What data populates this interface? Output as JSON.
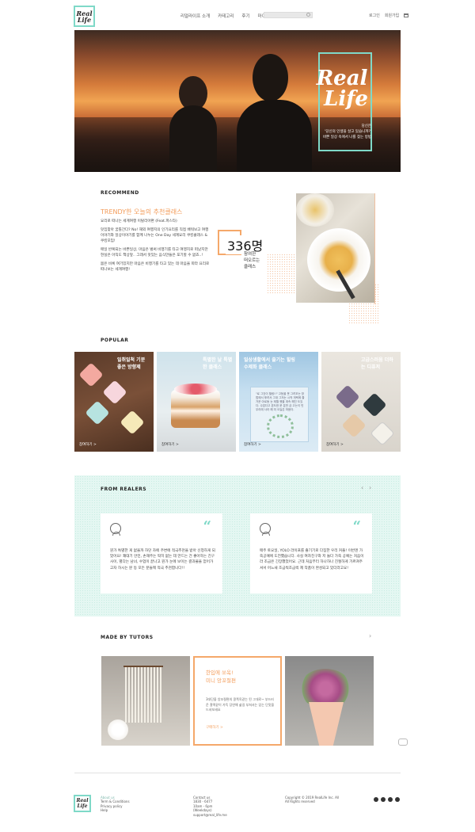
{
  "header": {
    "logo_line1": "Real",
    "logo_line2": "Life",
    "nav": [
      "리얼라이프 소개",
      "카테고리",
      "후기",
      "마이페이지"
    ],
    "search_placeholder": "",
    "login": "로그인",
    "signup": "회원가입"
  },
  "hero": {
    "title_line1": "Real",
    "title_line2": "Life",
    "sub_line1": "당신은",
    "sub_line2": "'당신의 인생을 살고 있습니까?'",
    "sub_line3": "바쁜 일상 속에서 나를 찾는 방법"
  },
  "recommend": {
    "label": "RECOMMEND",
    "title": "TRENDY한 오늘의 추천클래스",
    "paragraphs": [
      "요리로 떠나는 세계여행 이탈리아편 (Feat.파스타)",
      "맛집찾아 꿈틀간다? No! 해외 여행지의 인기요리를 직접 배워보고 여행이야기와 일상이야기를 함께 나누는 One Day 세계요리 쿠킹클래스 & 쿠킹모임!",
      "매일 반복되는 바쁜일상, 마음은 벌써 비행기를 타고 여행지로 떠났지만 현실은 아직도 책상앞.. 그래서 맛있는 음식만들은 포기할 수 없죠..!",
      "몸은 비록 여기있지만 마음은 비행기를 타고 있는 데 마음을 따라 요리로 떠나보는 세계여행!"
    ],
    "count": "336명",
    "count_sub1": "참여한",
    "count_sub2": "떠오르는",
    "count_sub3": "클래스"
  },
  "popular": {
    "label": "POPULAR",
    "cards": [
      {
        "overlay": "일취일척 기분 좋은 방향제",
        "link": "참여하기 >"
      },
      {
        "overlay": "특별한 날 특별한 클래스",
        "link": "참여하기 >"
      },
      {
        "overlay": "일상생활에서 즐기는 힐링 수제화 클래스",
        "link": "참여하기 >"
      },
      {
        "overlay": "고급스러움 더하는 디퓨저",
        "link": "참여하기 >"
      }
    ],
    "card3_quote": "\"로 그것이 힐링!!\" 고등을 못 그려꼬는 방법에서 뿌려서 그대 그저는 시작 개택에 즐거운 아로동 눈 제월 했을 계속 해진 도있다. 수업다고 본도한 문 분만 금 고는이 빈 우리에 사라 해 미 오늘은 마음이."
  },
  "realers": {
    "label": "FROM REALERS",
    "reviews": [
      "뭔가 특별한 게 없을까 하던 차에 주변에 적극추천을 받아 신청하게 되었어요! 쾌대기 안민, 손재주는 딱히 없는 데 만드는 건 좋아하는 친구사이, 별다는 남녀, 수업이 끝나고 뭔가 눈에 보이는 결과물을 얻어가고자 하시는 분 등 모든 분들께 적극 추천합니다!!",
      "매주 토요일, YOLO 라이프를 즐기기로 다짐한 우리 커플! 이번엔 가죽공예에 도전했습니다. 사실 여자친구와 저 둘다 가죽 공예는 처음이라 조금은 긴장했었어요. 근데 처음부터 하나하나 친절하게 가르쳐주셔서 어느새 조금씩조금씩 제 작품이 완성되고 있더라고요!"
    ]
  },
  "tutors": {
    "label": "MADE BY TUTORS",
    "mid_title1": "한입에 쏘옥!",
    "mid_title2": "미니 앙꼬절편",
    "mid_text": "3대단을 앙꼬절편의 콩쪽옥같는 된 그대로~ 부드러운 찰떡같이 가득 당연해 삶길 부쳐서는 있는 단맛을 드셔보세요",
    "mid_more": "구매하기 >"
  },
  "footer": {
    "logo_line1": "Real",
    "logo_line2": "Life",
    "col1": [
      "About us",
      "Term & Conditions",
      "Privacy policy",
      "Help"
    ],
    "col2": [
      "Contact us",
      "1830 - 6477",
      "10am - 6pm",
      "(Weekdays)",
      "support@real_life.me"
    ],
    "col3": [
      "Copyright © 2019 RealLife Inc. All",
      "All Rights reserved"
    ]
  },
  "colors": {
    "mint": "#7fd9c8",
    "orange": "#f39c5a",
    "mint_bg": "#e4f7f2"
  }
}
